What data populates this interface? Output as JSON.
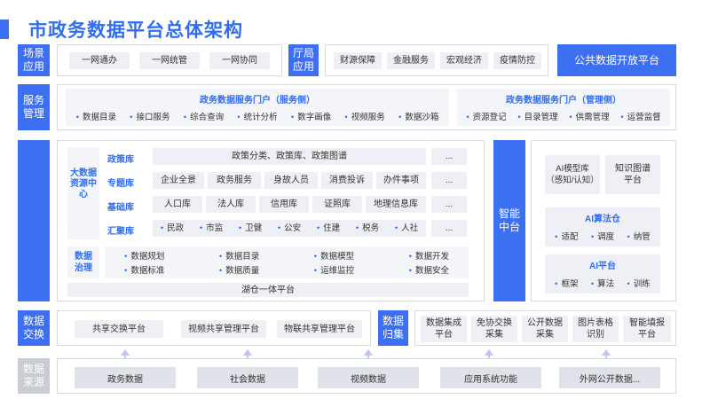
{
  "title": "市政务数据平台总体架构",
  "scene": {
    "label": "场景\n应用",
    "items": [
      "一网通办",
      "一网统管",
      "一网协同"
    ],
    "dept_label": "厅局\n应用",
    "dept_items": [
      "财源保障",
      "金融服务",
      "宏观经济",
      "疫情防控"
    ],
    "open_platform": "公共数据开放平台"
  },
  "service": {
    "label": "服务\n管理",
    "portal_service": {
      "title": "政务数据服务门户（服务侧）",
      "items": [
        "数据目录",
        "接口服务",
        "综合查询",
        "统计分析",
        "数字画像",
        "视频服务",
        "数据沙箱"
      ]
    },
    "portal_manage": {
      "title": "政务数据服务门户（管理侧）",
      "items": [
        "资源登记",
        "目录管理",
        "供需管理",
        "运营监督"
      ]
    }
  },
  "data_center": {
    "label": "大数据资源中心",
    "libs": [
      {
        "name": "政策库",
        "items": [
          "政策分类、政策库、政策图谱"
        ],
        "more": "..."
      },
      {
        "name": "专题库",
        "items": [
          "企业全景",
          "政务服务",
          "身故人员",
          "消费投诉",
          "办件事项"
        ],
        "more": "..."
      },
      {
        "name": "基础库",
        "items": [
          "人口库",
          "法人库",
          "信用库",
          "证照库",
          "地理信息库"
        ],
        "more": "..."
      },
      {
        "name": "汇聚库",
        "items": [
          "民政",
          "市监",
          "卫健",
          "公安",
          "住建",
          "税务",
          "人社"
        ],
        "more": "..."
      }
    ],
    "governance_label": "数据\n治理",
    "governance_row1": [
      "数据规划",
      "数据目录",
      "数据模型",
      "数据开发"
    ],
    "governance_row2": [
      "数据标准",
      "数据质量",
      "运维监控",
      "数据安全"
    ],
    "lake": "湖仓一体平台"
  },
  "smart": {
    "label": "智能\n中台",
    "model_lib": "AI模型库\n（感知/认知）",
    "kg": "知识图谱\n平台",
    "algo_title": "AI算法仓",
    "algo_items": [
      "适配",
      "调度",
      "纳管"
    ],
    "ai_title": "AI平台",
    "ai_items": [
      "框架",
      "算法",
      "训练"
    ]
  },
  "exchange": {
    "label": "数据\n交换",
    "items": [
      "共享交换平台",
      "视频共享管理平台",
      "物联共享管理平台"
    ],
    "collect_label": "数据\n归集",
    "collect_items": [
      "数据集成\n平台",
      "免协交换\n采集",
      "公开数据\n采集",
      "图片表格\n识别",
      "智能填报\n平台"
    ]
  },
  "source": {
    "label": "数据\n来源",
    "items": [
      "政务数据",
      "社会数据",
      "视频数据",
      "应用系统功能",
      "外网公开数据..."
    ]
  },
  "colors": {
    "accent": "#3d6ff2",
    "chip": "#eef0f5",
    "gray_label": "#c9ccd3"
  }
}
